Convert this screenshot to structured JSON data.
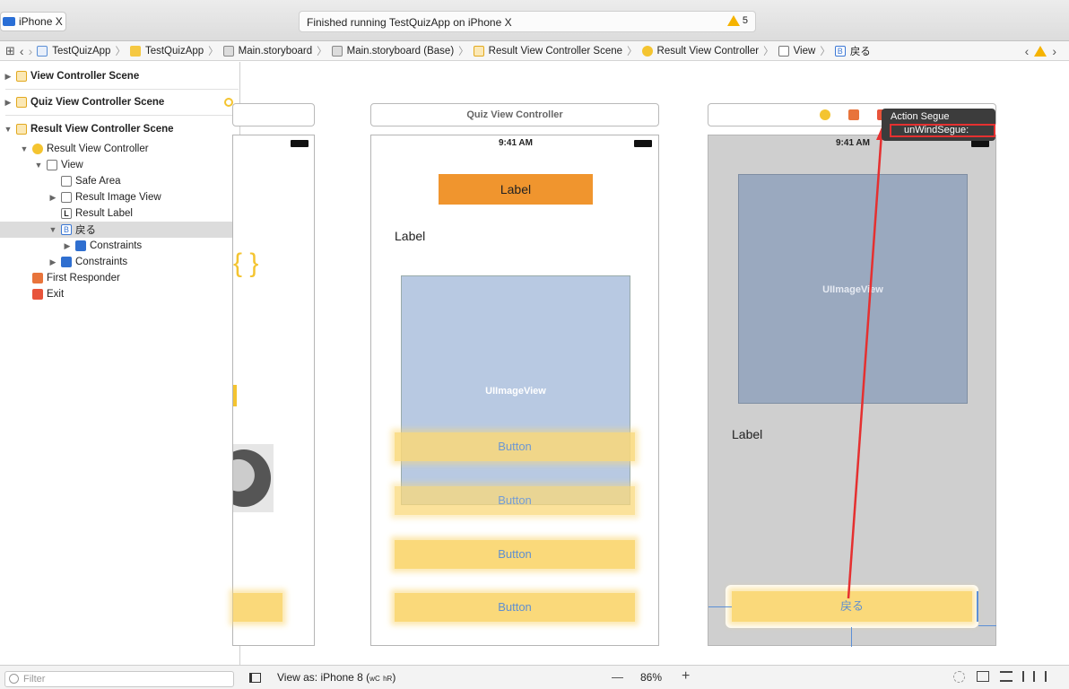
{
  "toolbar": {
    "scheme": "iPhone X",
    "activity": "Finished running TestQuizApp on iPhone X",
    "warning_count": "5"
  },
  "jumpbar": {
    "crumbs": [
      "TestQuizApp",
      "TestQuizApp",
      "Main.storyboard",
      "Main.storyboard (Base)",
      "Result View Controller Scene",
      "Result View Controller",
      "View",
      "戻る"
    ]
  },
  "outline": {
    "scenes": [
      {
        "label": "View Controller Scene"
      },
      {
        "label": "Quiz View Controller Scene"
      },
      {
        "label": "Result View Controller Scene"
      }
    ],
    "rows": [
      {
        "label": "Result View Controller"
      },
      {
        "label": "View"
      },
      {
        "label": "Safe Area"
      },
      {
        "label": "Result Image View"
      },
      {
        "label": "Result Label"
      },
      {
        "label": "戻る"
      },
      {
        "label": "Constraints"
      },
      {
        "label": "Constraints"
      },
      {
        "label": "First Responder"
      },
      {
        "label": "Exit"
      }
    ],
    "filter_placeholder": "Filter"
  },
  "canvas": {
    "quiz": {
      "title": "Quiz View Controller",
      "time": "9:41 AM",
      "top_label": "Label",
      "label": "Label",
      "image_view": "UIImageView",
      "buttons": [
        "Button",
        "Button",
        "Button",
        "Button"
      ]
    },
    "result": {
      "time": "9:41 AM",
      "image_view": "UIImageView",
      "label": "Label",
      "back_button": "戻る"
    },
    "segue_menu": {
      "header": "Action Segue",
      "item": "unWindSegue:"
    },
    "left_fragment_brace": "{ }"
  },
  "bottombar": {
    "view_as": "View as: iPhone 8 (",
    "size_class_w": "wC",
    "size_class_h": "hR",
    "view_as_close": ")",
    "zoom_minus": "—",
    "zoom": "86%",
    "zoom_plus": "+"
  },
  "colors": {
    "accent_yellow": "#f4c430",
    "label_orange": "#f0952e",
    "button_yellow": "#fad97a",
    "segue_red": "#e53030",
    "image_view_blue": "#b8c9e2"
  }
}
